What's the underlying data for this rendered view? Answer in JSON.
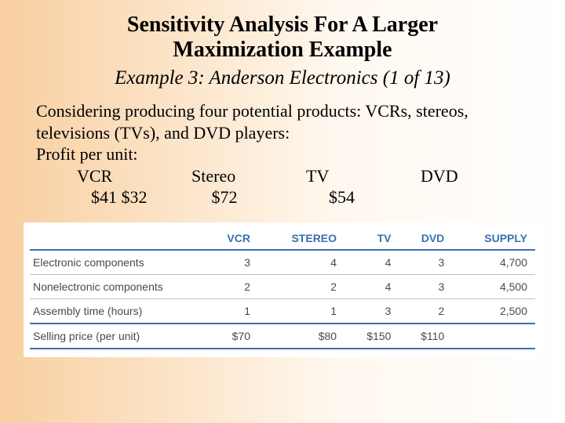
{
  "title_l1": "Sensitivity Analysis For A Larger",
  "title_l2": "Maximization Example",
  "subtitle": "Example 3: Anderson Electronics (1 of 13)",
  "body_l1": "Considering producing four potential products: VCRs, stereos,",
  "body_l2": "televisions (TVs), and DVD players:",
  "profit_label": "Profit per unit:",
  "profit_headers": {
    "vcr": "VCR",
    "stereo": "Stereo",
    "tv": "TV",
    "dvd": "DVD"
  },
  "profit_values": {
    "vcr": "$41   $32",
    "stereo": "$72",
    "tv": "$54",
    "dvd": ""
  },
  "table": {
    "headers": [
      "",
      "VCR",
      "STEREO",
      "TV",
      "DVD",
      "SUPPLY"
    ],
    "rows": [
      {
        "label": "Electronic components",
        "vcr": "3",
        "stereo": "4",
        "tv": "4",
        "dvd": "3",
        "supply": "4,700"
      },
      {
        "label": "Nonelectronic components",
        "vcr": "2",
        "stereo": "2",
        "tv": "4",
        "dvd": "3",
        "supply": "4,500"
      },
      {
        "label": "Assembly time (hours)",
        "vcr": "1",
        "stereo": "1",
        "tv": "3",
        "dvd": "2",
        "supply": "2,500"
      },
      {
        "label": "Selling price (per unit)",
        "vcr": "$70",
        "stereo": "$80",
        "tv": "$150",
        "dvd": "$110",
        "supply": ""
      }
    ]
  }
}
